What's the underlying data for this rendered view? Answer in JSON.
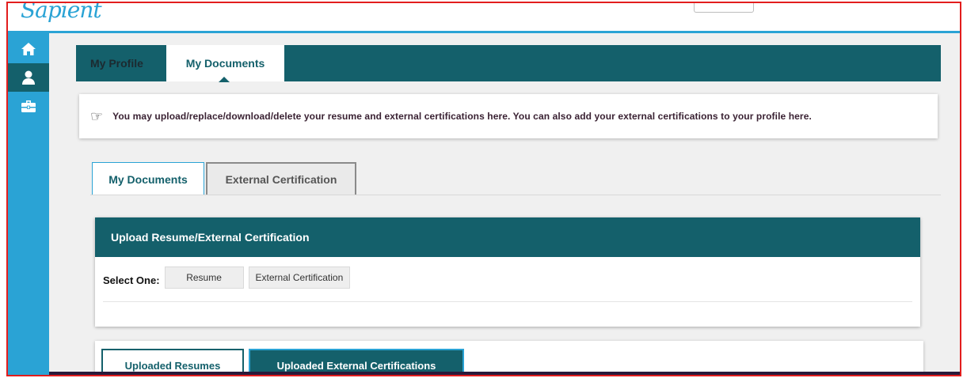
{
  "brand": {
    "logo_text": "Sapient"
  },
  "sidebar": {
    "items": [
      {
        "icon": "home-icon"
      },
      {
        "icon": "user-icon"
      },
      {
        "icon": "toolbox-icon"
      }
    ]
  },
  "header_tabs": {
    "items": [
      {
        "label": "My Profile"
      },
      {
        "label": "My Documents"
      }
    ],
    "active": "My Documents"
  },
  "notice": {
    "icon": "pointing-hand-icon",
    "text": "You may upload/replace/download/delete your resume and external certifications here.  You can also add your external certifications to your profile here."
  },
  "sub_tabs": {
    "items": [
      {
        "label": "My Documents"
      },
      {
        "label": "External Certification"
      }
    ],
    "active": "My Documents"
  },
  "upload_panel": {
    "title": "Upload Resume/External Certification",
    "select_label": "Select One:",
    "options": [
      {
        "label": "Resume"
      },
      {
        "label": "External Certification"
      }
    ]
  },
  "uploaded_tabs": {
    "items": [
      {
        "label": "Uploaded Resumes"
      },
      {
        "label": "Uploaded External Certifications"
      }
    ],
    "active": "Uploaded External Certifications"
  },
  "colors": {
    "accent": "#2aa3d5",
    "teal": "#14606b",
    "highlight_border": "#e21d1d"
  }
}
